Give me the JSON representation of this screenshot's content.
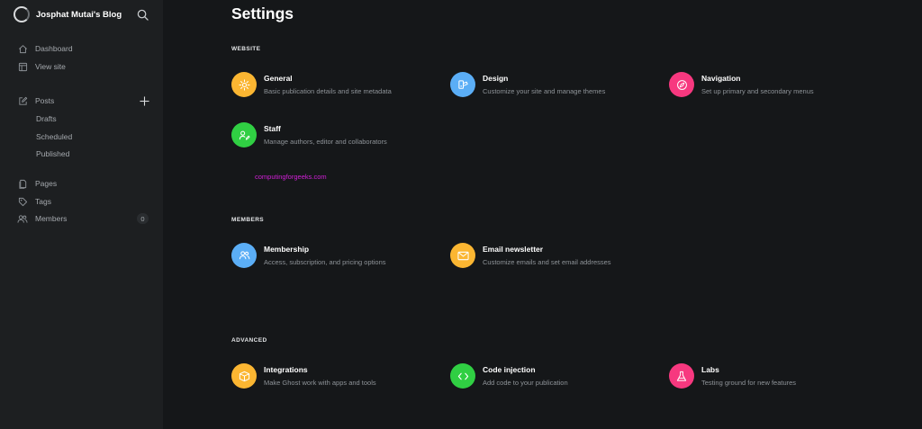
{
  "sidebar": {
    "brand_title": "Josphat Mutai's Blog",
    "items": [
      {
        "label": "Dashboard",
        "icon": "home-icon"
      },
      {
        "label": "View site",
        "icon": "browser-icon"
      },
      {
        "label": "Posts",
        "icon": "edit-icon"
      },
      {
        "label": "Pages",
        "icon": "page-icon"
      },
      {
        "label": "Tags",
        "icon": "tag-icon"
      },
      {
        "label": "Members",
        "icon": "members-icon"
      }
    ],
    "post_subitems": [
      "Drafts",
      "Scheduled",
      "Published"
    ],
    "members_count": "0"
  },
  "main": {
    "title": "Settings",
    "watermark": "computingforgeeks.com",
    "sections": [
      {
        "title": "WEBSITE",
        "cards": [
          {
            "title": "General",
            "desc": "Basic publication details and site metadata",
            "color": "#fbb632",
            "icon": "gear-icon"
          },
          {
            "title": "Design",
            "desc": "Customize your site and manage themes",
            "color": "#5baef6",
            "icon": "paint-brush-icon"
          },
          {
            "title": "Navigation",
            "desc": "Set up primary and secondary menus",
            "color": "#f7387f",
            "icon": "compass-icon"
          },
          {
            "title": "Staff",
            "desc": "Manage authors, editor and collaborators",
            "color": "#30cf43",
            "icon": "staff-icon"
          }
        ]
      },
      {
        "title": "MEMBERS",
        "cards": [
          {
            "title": "Membership",
            "desc": "Access, subscription, and pricing options",
            "color": "#5baef6",
            "icon": "membership-icon"
          },
          {
            "title": "Email newsletter",
            "desc": "Customize emails and set email addresses",
            "color": "#fbb632",
            "icon": "envelope-icon"
          }
        ]
      },
      {
        "title": "ADVANCED",
        "cards": [
          {
            "title": "Integrations",
            "desc": "Make Ghost work with apps and tools",
            "color": "#fbb632",
            "icon": "box-icon"
          },
          {
            "title": "Code injection",
            "desc": "Add code to your publication",
            "color": "#30cf43",
            "icon": "code-icon"
          },
          {
            "title": "Labs",
            "desc": "Testing ground for new features",
            "color": "#f7387f",
            "icon": "flask-icon"
          }
        ]
      }
    ]
  }
}
